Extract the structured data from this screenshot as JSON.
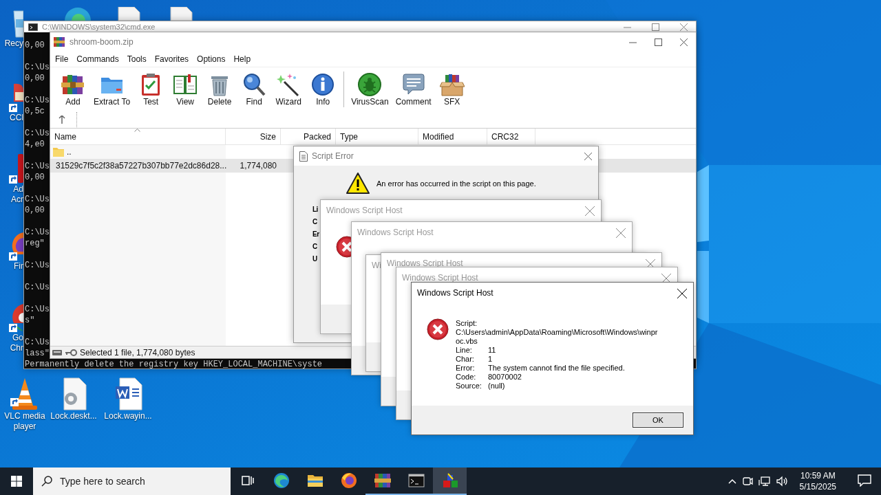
{
  "desktop_icons": [
    {
      "lines": [
        "Recy"
      ],
      "shortcut": false
    },
    {
      "lines": [
        "CCl"
      ],
      "shortcut": true
    },
    {
      "lines": [
        "Ad",
        "Acr"
      ],
      "shortcut": true
    },
    {
      "lines": [
        "Fir"
      ],
      "shortcut": true
    },
    {
      "lines": [
        "Go",
        "Chr"
      ],
      "shortcut": true
    },
    {
      "lines": [
        "VLC media",
        "player"
      ],
      "shortcut": true
    },
    {
      "lines": [
        "Lock.deskt..."
      ],
      "shortcut": false
    },
    {
      "lines": [
        "Lock.wayin..."
      ],
      "shortcut": false
    }
  ],
  "cmd_window": {
    "title": "C:\\WINDOWS\\system32\\cmd.exe",
    "blocks": [
      [
        "0,00"
      ],
      [
        "C:\\Us",
        "0,00"
      ],
      [
        "C:\\Us",
        "0,5c"
      ],
      [
        "C:\\Us",
        "4,e0"
      ],
      [
        "C:\\Us",
        "0,00"
      ],
      [
        "C:\\Us",
        "0,00"
      ],
      [
        "C:\\Us",
        "reg\""
      ],
      [
        "C:\\Us"
      ],
      [
        "C:\\Us"
      ],
      [
        "C:\\Us",
        "s\""
      ],
      [
        "C:\\Us",
        "lass\"",
        "Permanently delete the registry key HKEY_LOCAL_MACHINE\\syste"
      ]
    ]
  },
  "winrar": {
    "title": "shroom-boom.zip",
    "menu": [
      "File",
      "Commands",
      "Tools",
      "Favorites",
      "Options",
      "Help"
    ],
    "toolbar": [
      [
        "Add",
        "Extract To",
        "Test",
        "View",
        "Delete",
        "Find",
        "Wizard",
        "Info"
      ],
      [
        "VirusScan",
        "Comment",
        "SFX"
      ]
    ],
    "columns": [
      {
        "label": "Name",
        "sorted": true
      },
      {
        "label": "Size",
        "sorted": false
      },
      {
        "label": "Packed",
        "sorted": false
      },
      {
        "label": "Type",
        "sorted": false
      },
      {
        "label": "Modified",
        "sorted": false
      },
      {
        "label": "CRC32",
        "sorted": false
      }
    ],
    "rows": [
      {
        "kind": "folder",
        "name": "..",
        "selected": false
      },
      {
        "kind": "file",
        "name": "31529c7f5c2f38a57227b307bb77e2dc86d28...",
        "size": "1,774,080",
        "selected": true
      }
    ],
    "status": "Selected 1 file, 1,774,080 bytes"
  },
  "script_error": {
    "title": "Script Error",
    "message": "An error has occurred in the script on this page.",
    "labels": [
      "Li",
      "C",
      "Er",
      "C",
      "U"
    ]
  },
  "wsh_dialogs": [
    {
      "title": "Windows Script Host",
      "active": false
    },
    {
      "title": "Windows Script Host",
      "active": false
    },
    {
      "title": "Wi",
      "active": false
    },
    {
      "title": "Windows Script Host",
      "active": false
    },
    {
      "title": "Windows Script Host",
      "active": false
    },
    {
      "title": "Windows Script Host",
      "active": true,
      "script_label": "Script:",
      "script_path": [
        "C:\\Users\\admin\\AppData\\Roaming\\Microsoft\\Windows\\winpr",
        "oc.vbs"
      ],
      "fields": [
        {
          "label": "Line:",
          "value": "11"
        },
        {
          "label": "Char:",
          "value": "1"
        },
        {
          "label": "Error:",
          "value": "The system cannot find the file specified."
        },
        {
          "label": "Code:",
          "value": "80070002"
        },
        {
          "label": "Source:",
          "value": "(null)"
        }
      ],
      "button": "OK"
    }
  ],
  "taskbar": {
    "search": {
      "placeholder": "Type here to search"
    },
    "apps": [
      {
        "running": false,
        "active": false
      },
      {
        "running": false,
        "active": false
      },
      {
        "running": false,
        "active": false
      },
      {
        "running": true,
        "active": false
      },
      {
        "running": true,
        "active": false
      },
      {
        "running": true,
        "active": true
      }
    ],
    "time": "10:59 AM",
    "date": "5/15/2025"
  }
}
